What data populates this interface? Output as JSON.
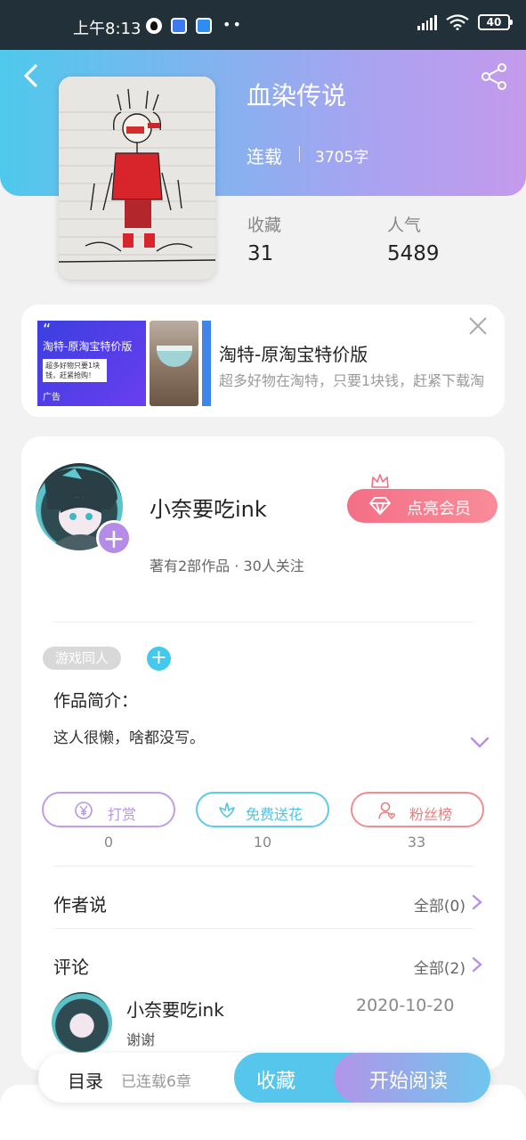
{
  "status_bar": {
    "time": "上午8:13",
    "dots": "••",
    "battery": "40"
  },
  "book": {
    "title": "血染传说",
    "status": "连载",
    "word_count": "3705字",
    "stats": [
      {
        "label": "收藏",
        "value": "31"
      },
      {
        "label": "人气",
        "value": "5489"
      }
    ]
  },
  "ad": {
    "image_title": "淘特-原淘宝特价版",
    "image_box_text": "超多好物只要1块钱，赶紧抢购！",
    "image_tag": "广告",
    "title": "淘特-原淘宝特价版",
    "description": "超多好物在淘特，只要1块钱，赶紧下载淘"
  },
  "author": {
    "name": "小奈要吃ink",
    "meta": "著有2部作品 · 30人关注",
    "vip_label": "点亮会员"
  },
  "tags": [
    "游戏同人"
  ],
  "intro": {
    "label": "作品简介：",
    "text": "这人很懒，啥都没写。"
  },
  "actions": [
    {
      "label": "打赏",
      "count": "0",
      "icon": "yen-icon",
      "color": "#b895e6"
    },
    {
      "label": "免费送花",
      "count": "10",
      "icon": "flower-icon",
      "color": "#4fc2e4"
    },
    {
      "label": "粉丝榜",
      "count": "33",
      "icon": "fans-icon",
      "color": "#e87f7f"
    }
  ],
  "author_says": {
    "label": "作者说",
    "link": "全部(0)"
  },
  "comments": {
    "label": "评论",
    "link": "全部(2)",
    "items": [
      {
        "user": "小奈要吃ink",
        "date": "2020-10-20",
        "text": "谢谢"
      }
    ]
  },
  "bottom_bar": {
    "toc": "目录",
    "chapters": "已连载6章",
    "favorite": "收藏",
    "start_reading": "开始阅读"
  },
  "colors": {
    "header_gradient_start": "#4ec9ec",
    "header_gradient_end": "#c49aec",
    "vip": "#f46f86",
    "accent_blue": "#56c6ec",
    "accent_purple": "#b48be6"
  }
}
